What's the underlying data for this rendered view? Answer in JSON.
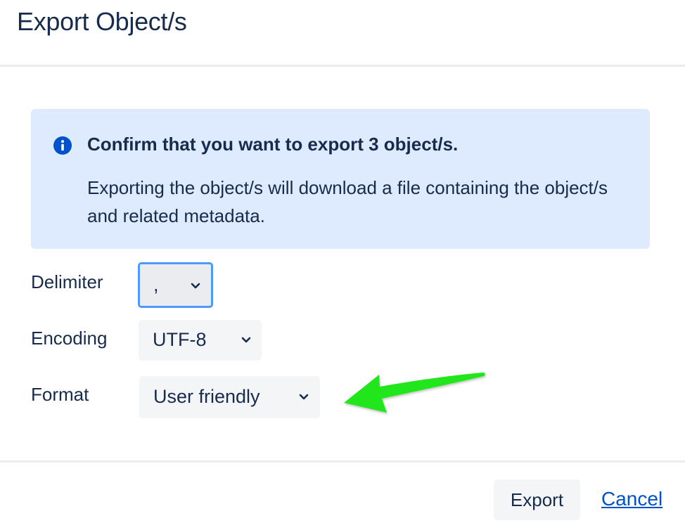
{
  "dialog": {
    "title": "Export Object/s"
  },
  "info": {
    "icon": "info-icon",
    "heading": "Confirm that you want to export 3 object/s.",
    "body": "Exporting the object/s will download a file containing the object/s and related metadata."
  },
  "fields": {
    "delimiter": {
      "label": "Delimiter",
      "value": ","
    },
    "encoding": {
      "label": "Encoding",
      "value": "UTF-8"
    },
    "format": {
      "label": "Format",
      "value": "User friendly"
    }
  },
  "footer": {
    "export_label": "Export",
    "cancel_label": "Cancel"
  },
  "colors": {
    "info_background": "#deebff",
    "info_icon": "#0052cc",
    "focus_ring": "#4c9aff",
    "annotation_arrow": "#22e61a",
    "link": "#0052cc"
  }
}
